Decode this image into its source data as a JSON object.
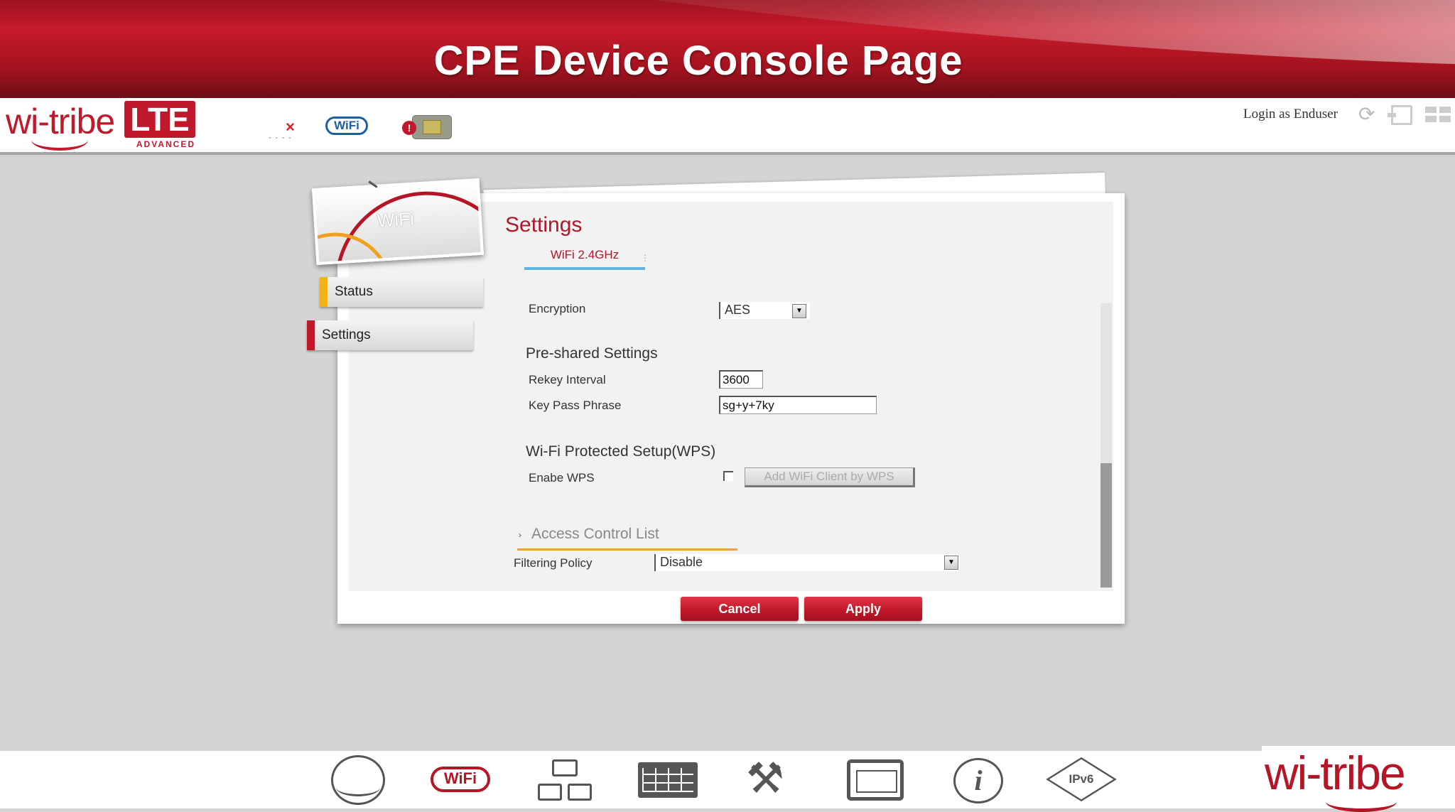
{
  "banner": {
    "title": "CPE Device Console Page"
  },
  "header": {
    "logo_text": "wi-tribe",
    "logo_badge": "LTE",
    "logo_sub": "ADVANCED",
    "wifi_badge": "WiFi",
    "login_text": "Login as Enduser"
  },
  "sidebar": {
    "card_label": "WiFi",
    "items": [
      {
        "label": "Status"
      },
      {
        "label": "Settings"
      }
    ]
  },
  "main": {
    "title": "Settings",
    "tab_label": "WiFi 2.4GHz",
    "encryption": {
      "label": "Encryption",
      "value": "AES"
    },
    "preshared": {
      "heading": "Pre-shared Settings",
      "rekey_label": "Rekey Interval",
      "rekey_value": "3600",
      "passphrase_label": "Key Pass Phrase",
      "passphrase_value": "sg+y+7ky"
    },
    "wps": {
      "heading": "Wi-Fi Protected Setup(WPS)",
      "enable_label": "Enabe WPS",
      "enabled": false,
      "button_label": "Add WiFi Client by WPS"
    },
    "acl": {
      "heading": "Access Control List",
      "filter_label": "Filtering Policy",
      "filter_value": "Disable"
    },
    "buttons": {
      "cancel": "Cancel",
      "apply": "Apply"
    }
  },
  "footer": {
    "wifi_label": "WiFi",
    "ipv6_label": "IPv6",
    "logo_text": "wi-tribe"
  },
  "colors": {
    "brand_red": "#c0192b",
    "tab_underline": "#5fb5e0",
    "status_accent": "#f2b21a",
    "acl_underline": "#f0a040"
  }
}
